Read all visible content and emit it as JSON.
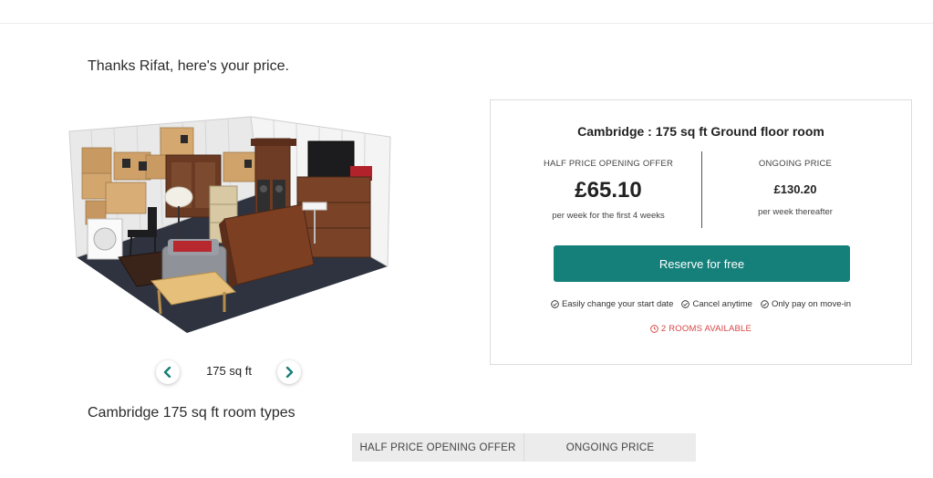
{
  "greeting": "Thanks Rifat, here's your price.",
  "room_selector": {
    "size_label": "175 sq ft",
    "prev_icon": "chevron-left-icon",
    "next_icon": "chevron-right-icon"
  },
  "price_card": {
    "title": "Cambridge : 175 sq ft Ground floor room",
    "offer": {
      "label": "HALF PRICE OPENING OFFER",
      "price": "£65.10",
      "note": "per week for the first 4 weeks"
    },
    "ongoing": {
      "label": "ONGOING PRICE",
      "price": "£130.20",
      "note": "per week thereafter"
    },
    "reserve_label": "Reserve for free",
    "features": [
      "Easily change your start date",
      "Cancel anytime",
      "Only pay on move-in"
    ],
    "availability": "2 ROOMS AVAILABLE"
  },
  "room_types": {
    "title": "Cambridge 175 sq ft room types",
    "columns": [
      "HALF PRICE OPENING OFFER",
      "ONGOING PRICE"
    ]
  },
  "colors": {
    "accent": "#157f7a",
    "alert": "#d64545",
    "table_header_bg": "#ececec"
  }
}
